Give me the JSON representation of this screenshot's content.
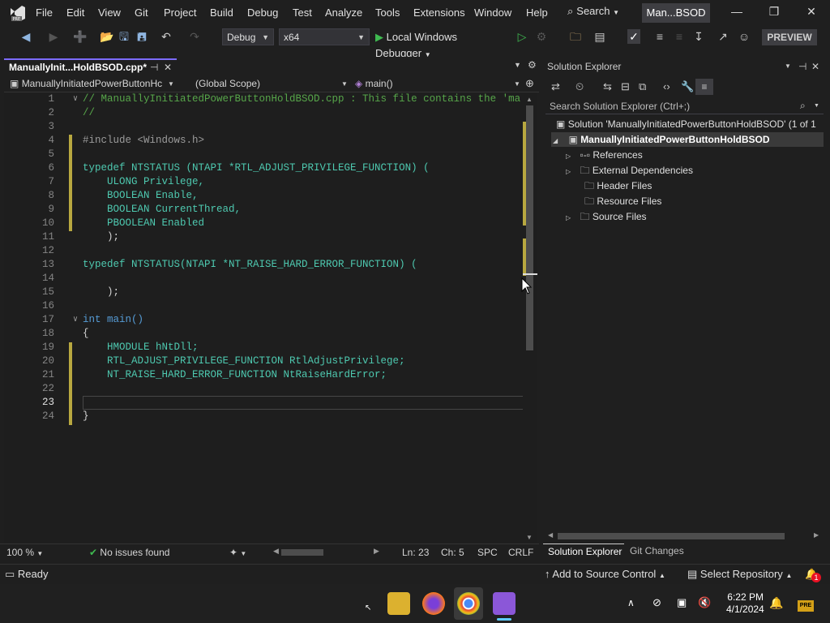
{
  "menu": {
    "items": [
      "File",
      "Edit",
      "View",
      "Git",
      "Project",
      "Build",
      "Debug",
      "Test",
      "Analyze",
      "Tools",
      "Extensions",
      "Window",
      "Help"
    ],
    "search_label": "Search",
    "solution_badge": "Man...BSOD"
  },
  "toolbar": {
    "config": "Debug",
    "platform": "x64",
    "run_label": "Local Windows Debugger",
    "preview_label": "PREVIEW"
  },
  "editor": {
    "tab_title": "ManuallyInit...HoldBSOD.cpp*",
    "nav_project": "ManuallyInitiatedPowerButtonHc",
    "nav_scope": "(Global Scope)",
    "nav_member": "main()",
    "lines": [
      {
        "n": "1",
        "t": "// ManuallyInitiatedPowerButtonHoldBSOD.cpp : This file contains the 'ma"
      },
      {
        "n": "2",
        "t": "//"
      },
      {
        "n": "3",
        "t": ""
      },
      {
        "n": "4",
        "t": "#include <Windows.h>"
      },
      {
        "n": "5",
        "t": ""
      },
      {
        "n": "6",
        "t": "typedef NTSTATUS (NTAPI *RTL_ADJUST_PRIVILEGE_FUNCTION) ("
      },
      {
        "n": "7",
        "t": "    ULONG Privilege,"
      },
      {
        "n": "8",
        "t": "    BOOLEAN Enable,"
      },
      {
        "n": "9",
        "t": "    BOOLEAN CurrentThread,"
      },
      {
        "n": "10",
        "t": "    PBOOLEAN Enabled"
      },
      {
        "n": "11",
        "t": "    );"
      },
      {
        "n": "12",
        "t": ""
      },
      {
        "n": "13",
        "t": "typedef NTSTATUS(NTAPI *NT_RAISE_HARD_ERROR_FUNCTION) ("
      },
      {
        "n": "14",
        "t": ""
      },
      {
        "n": "15",
        "t": "    );"
      },
      {
        "n": "16",
        "t": ""
      },
      {
        "n": "17",
        "t": "int main()"
      },
      {
        "n": "18",
        "t": "{"
      },
      {
        "n": "19",
        "t": "    HMODULE hNtDll;"
      },
      {
        "n": "20",
        "t": "    RTL_ADJUST_PRIVILEGE_FUNCTION RtlAdjustPrivilege;"
      },
      {
        "n": "21",
        "t": "    NT_RAISE_HARD_ERROR_FUNCTION NtRaiseHardError;"
      },
      {
        "n": "22",
        "t": ""
      },
      {
        "n": "23",
        "t": ""
      },
      {
        "n": "24",
        "t": "}"
      }
    ],
    "zoom": "100 %",
    "issues": "No issues found",
    "ln": "Ln: 23",
    "ch": "Ch: 5",
    "spc": "SPC",
    "eol": "CRLF"
  },
  "solution_explorer": {
    "title": "Solution Explorer",
    "search_placeholder": "Search Solution Explorer (Ctrl+;)",
    "solution_label": "Solution 'ManuallyInitiatedPowerButtonHoldBSOD' (1 of 1",
    "project_label": "ManuallyInitiatedPowerButtonHoldBSOD",
    "items": [
      "References",
      "External Dependencies",
      "Header Files",
      "Resource Files",
      "Source Files"
    ],
    "tab_active": "Solution Explorer",
    "tab_other": "Git Changes"
  },
  "statusbar": {
    "ready": "Ready",
    "source_control": "Add to Source Control",
    "repository": "Select Repository",
    "notifications": "1"
  },
  "taskbar": {
    "time": "6:22 PM",
    "date": "4/1/2024"
  }
}
